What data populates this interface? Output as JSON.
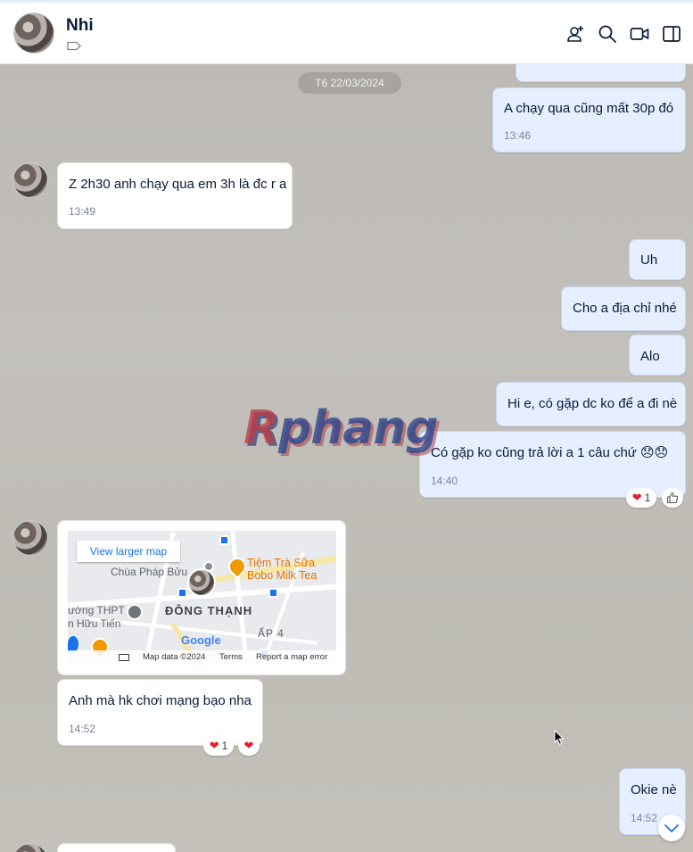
{
  "header": {
    "contact_name": "Nhi"
  },
  "chat": {
    "date_separator": "T6 22/03/2024",
    "messages": [
      {
        "text": "A chạy qua cũng mất 30p đó",
        "time": "13:46"
      },
      {
        "text": "Z 2h30 anh chạy qua em 3h là đc r a",
        "time": "13:49"
      },
      {
        "text": "Uh"
      },
      {
        "text": "Cho a địa chỉ nhé"
      },
      {
        "text": "Alo"
      },
      {
        "text": "Hi e, có gặp dc ko để a đi nè"
      },
      {
        "text": "Có gặp ko cũng trả lời a 1 câu chứ 😞😞",
        "time": "14:40",
        "reaction_count": "1"
      },
      {
        "text": "Anh mà hk chơi mạng bạo nha",
        "time": "14:52",
        "reaction_count": "1"
      },
      {
        "text": "Okie nè",
        "time": "14:52"
      }
    ],
    "map": {
      "view_larger": "View larger map",
      "labels": {
        "pagoda": "Chùa Pháp Bửu",
        "shop1": "Tiệm Trà Sữa",
        "shop2": "Bobo Milk Tea",
        "school1": "ường THPT",
        "school2": "n Hữu Tiến",
        "district": "ĐÔNG THẠNH",
        "hamlet": "ẤP 4",
        "google": "Google"
      },
      "footer": {
        "map_data": "Map data ©2024",
        "terms": "Terms",
        "report": "Report a map error"
      }
    },
    "watermark": {
      "part1": "R",
      "part2": "phang"
    }
  },
  "colors": {
    "my_bubble": "#e5efff",
    "their_bubble": "#ffffff",
    "background": "#bfbcb7",
    "accent": "#1a73e8",
    "heart": "#e0202f"
  },
  "icons": [
    "add-member-icon",
    "search-icon",
    "video-call-icon",
    "sidebar-toggle-icon",
    "tag-icon",
    "chevron-down-icon",
    "thumbs-up-icon",
    "heart-icon"
  ]
}
